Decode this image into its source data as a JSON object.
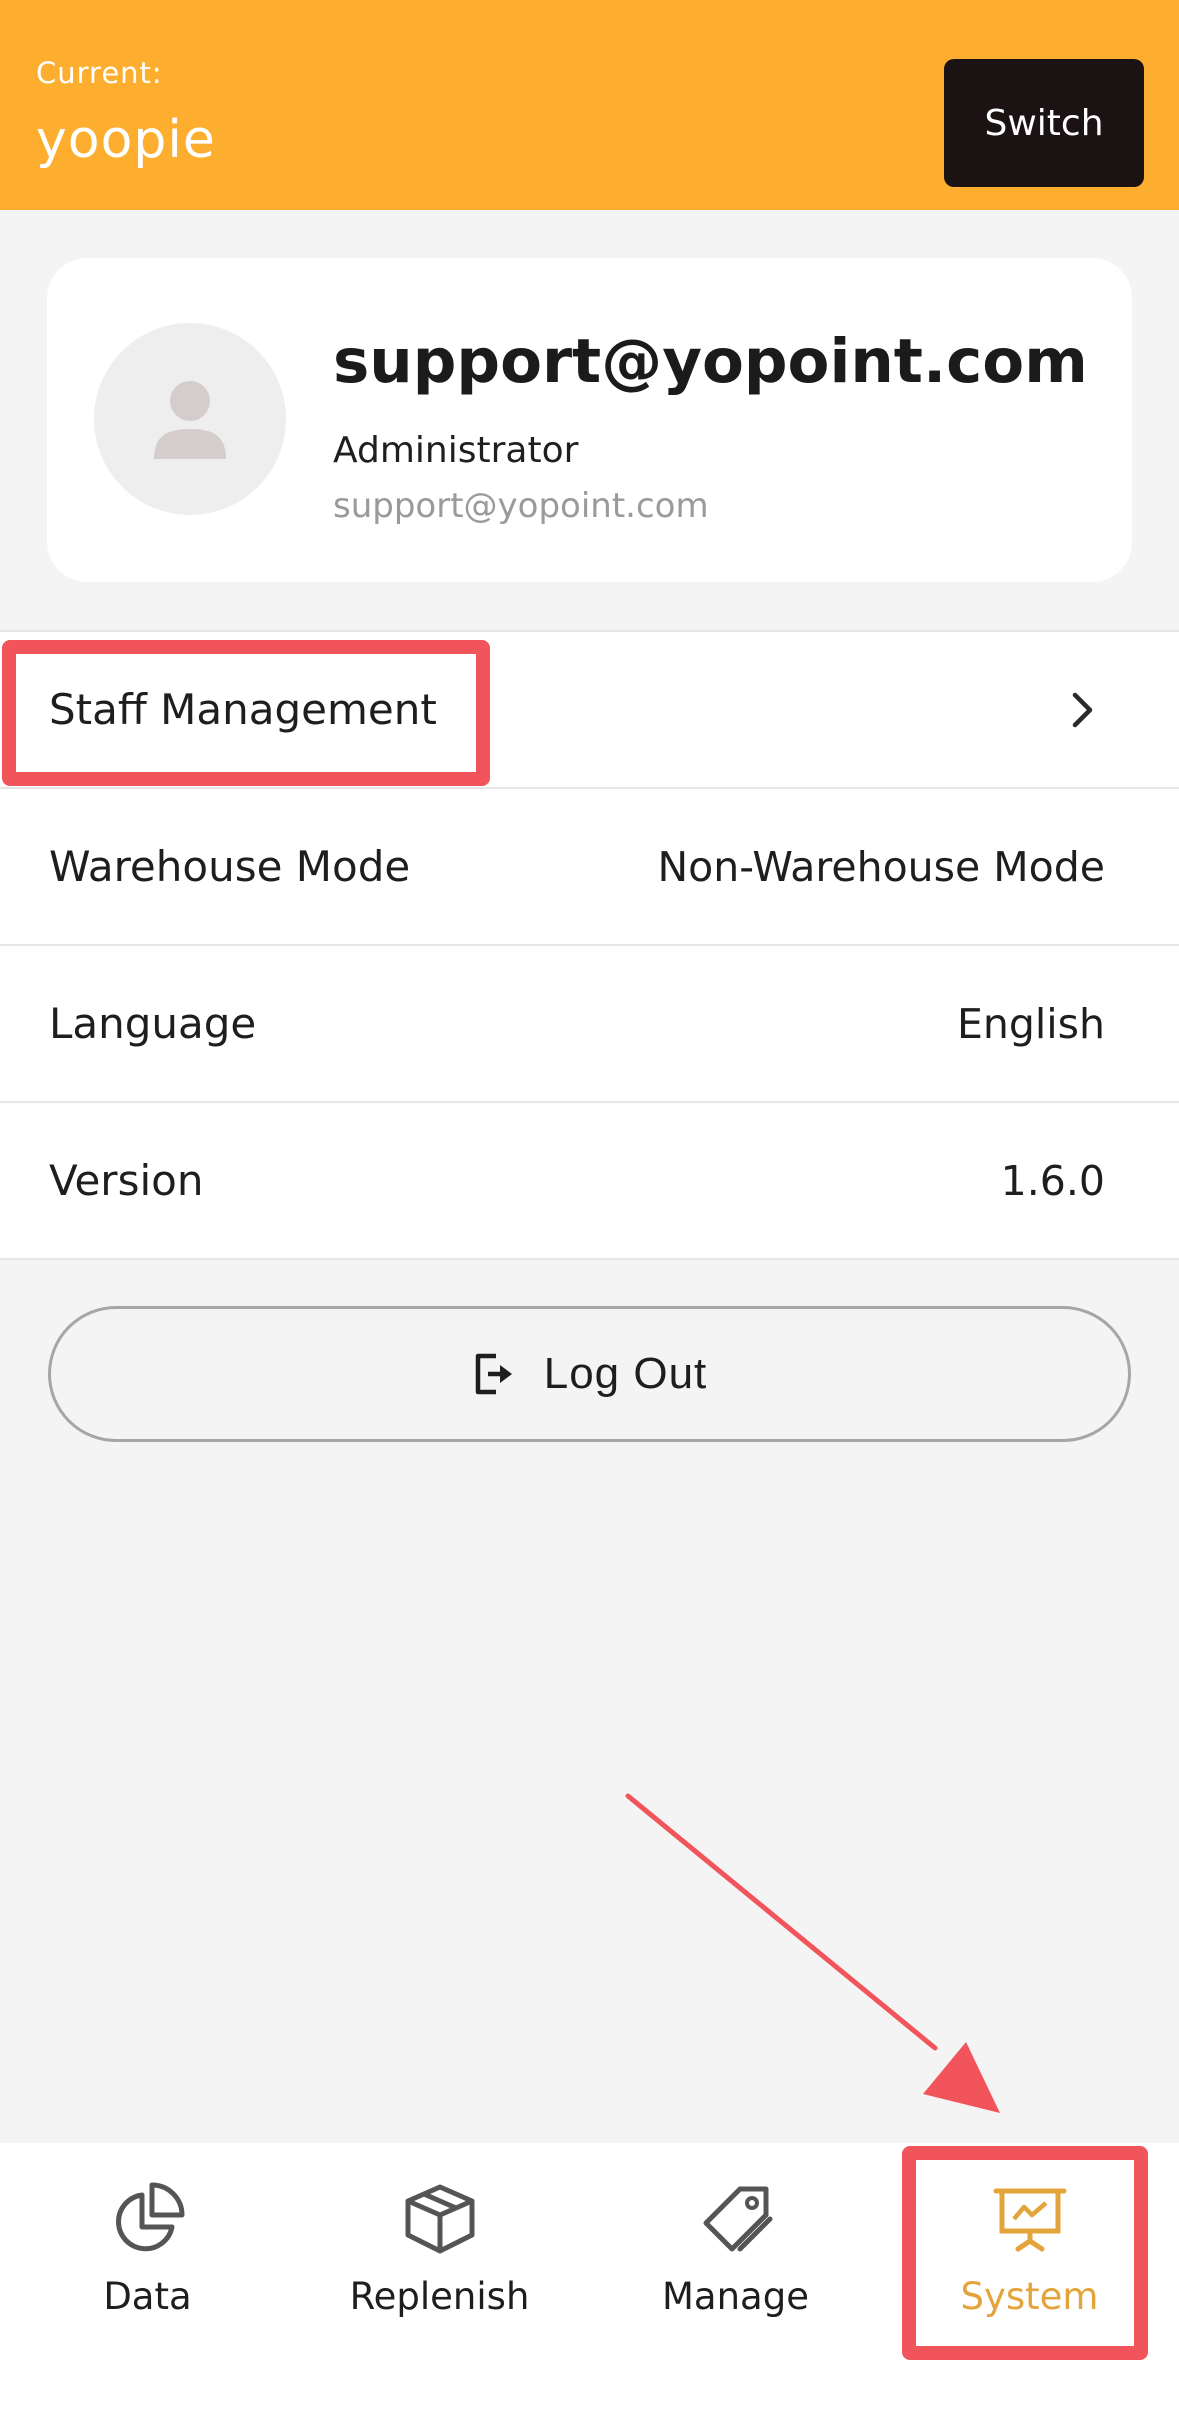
{
  "header": {
    "current_label": "Current:",
    "current_name": "yoopie",
    "switch_label": "Switch",
    "background": "#fdae2f"
  },
  "profile": {
    "title": "support@yopoint.com",
    "role": "Administrator",
    "email": "support@yopoint.com",
    "avatar_icon": "person-icon"
  },
  "settings": {
    "staff_label": "Staff Management",
    "warehouse_label": "Warehouse Mode",
    "warehouse_value": "Non-Warehouse Mode",
    "language_label": "Language",
    "language_value": "English",
    "version_label": "Version",
    "version_value": "1.6.0"
  },
  "logout": {
    "label": "Log Out",
    "icon": "logout-icon"
  },
  "tabs": [
    {
      "label": "Data",
      "icon": "pie-chart-icon"
    },
    {
      "label": "Replenish",
      "icon": "box-icon"
    },
    {
      "label": "Manage",
      "icon": "tag-icon"
    },
    {
      "label": "System",
      "icon": "presentation-board-icon",
      "active": true
    }
  ],
  "colors": {
    "accent": "#fdae2f",
    "active_tab": "#e3a43b",
    "annotation_red": "#f2545b",
    "switch_bg": "#1b1213"
  }
}
